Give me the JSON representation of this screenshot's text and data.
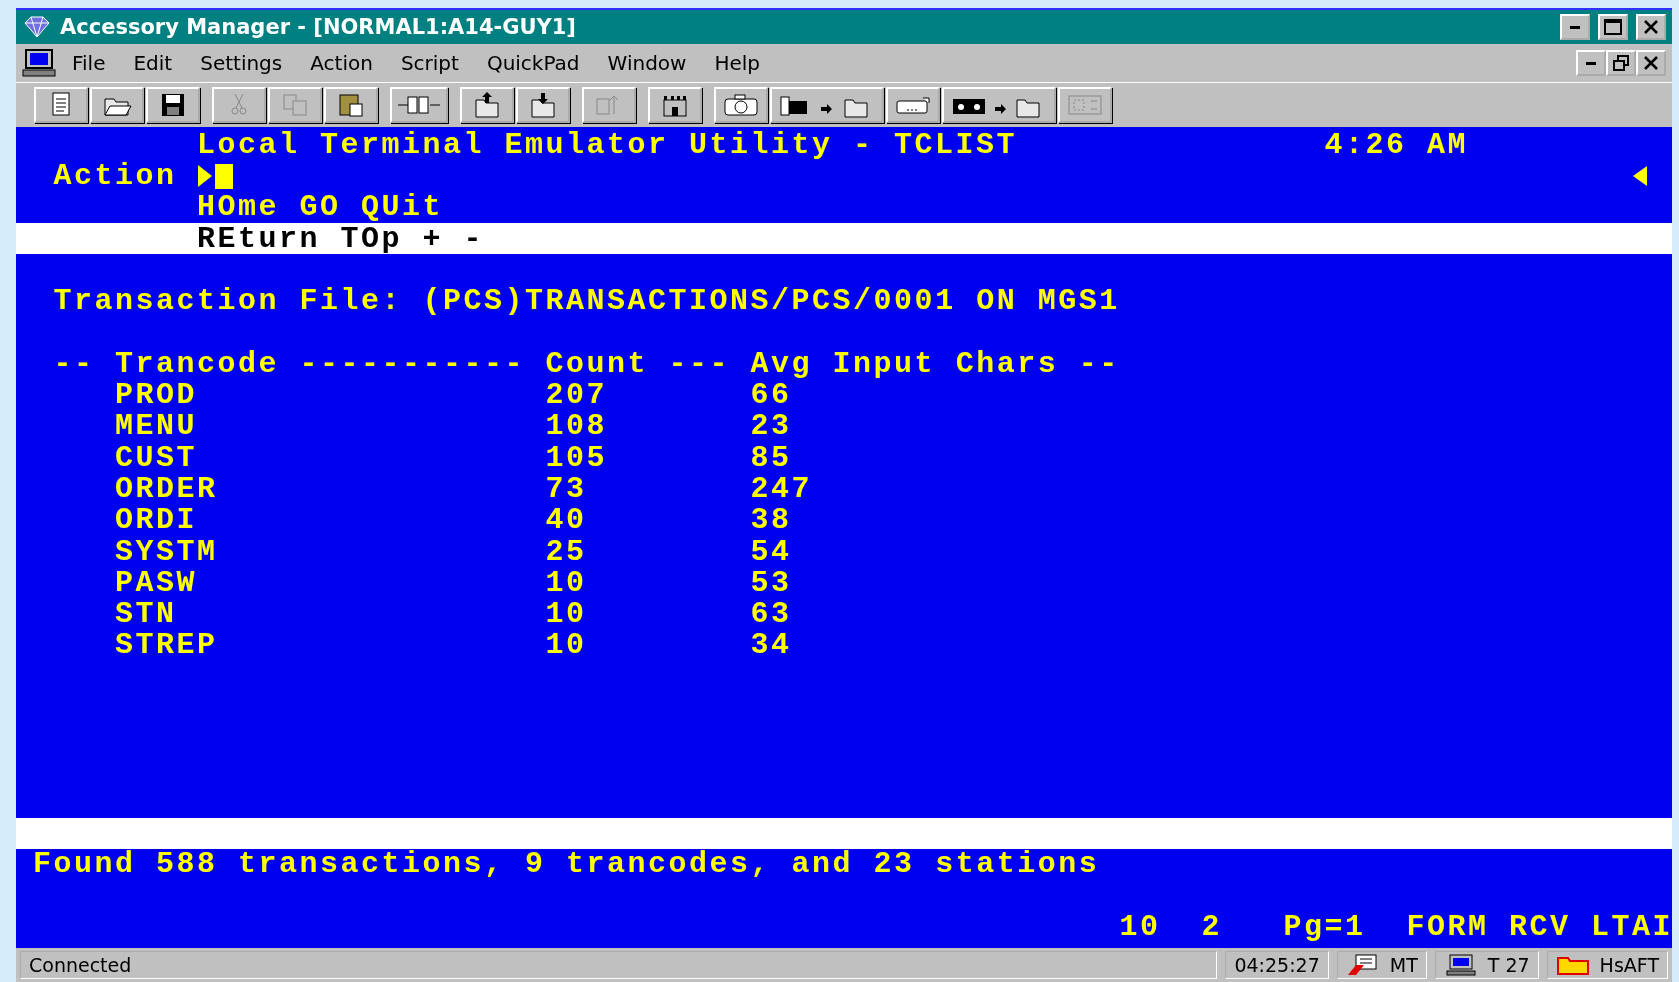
{
  "window": {
    "title": "Accessory Manager - [NORMAL1:A14-GUY1]"
  },
  "menu": [
    "File",
    "Edit",
    "Settings",
    "Action",
    "Script",
    "QuickPad",
    "Window",
    "Help"
  ],
  "toolbar": [
    {
      "kind": "document",
      "disabled": false
    },
    {
      "kind": "open",
      "disabled": false
    },
    {
      "kind": "save",
      "disabled": false
    },
    {
      "kind": "cut",
      "disabled": true
    },
    {
      "kind": "copy",
      "disabled": true
    },
    {
      "kind": "paste",
      "disabled": false
    },
    {
      "kind": "plug",
      "disabled": false
    },
    {
      "kind": "upload",
      "disabled": false
    },
    {
      "kind": "download",
      "disabled": false
    },
    {
      "kind": "send",
      "disabled": true
    },
    {
      "kind": "castle",
      "disabled": false
    },
    {
      "kind": "camera",
      "disabled": false
    },
    {
      "kind": "film-to-folder",
      "disabled": false
    },
    {
      "kind": "camcorder",
      "disabled": false
    },
    {
      "kind": "tape-to-folder",
      "disabled": false
    },
    {
      "kind": "panel",
      "disabled": true
    }
  ],
  "terminal": {
    "title": "Local Terminal Emulator Utility - TCLIST",
    "clock": "4:26 AM",
    "action_label": "Action",
    "commands": "HOme GO QUit",
    "return_line": "REturn TOp + -",
    "transaction_file": "Transaction File: (PCS)TRANSACTIONS/PCS/0001 ON MGS1",
    "header": "-- Trancode ----------- Count --- Avg Input Chars --",
    "rows": [
      {
        "trancode": "PROD",
        "count": "207",
        "avg": "66"
      },
      {
        "trancode": "MENU",
        "count": "108",
        "avg": "23"
      },
      {
        "trancode": "CUST",
        "count": "105",
        "avg": "85"
      },
      {
        "trancode": "ORDER",
        "count": "73",
        "avg": "247"
      },
      {
        "trancode": "ORDI",
        "count": "40",
        "avg": "38"
      },
      {
        "trancode": "SYSTM",
        "count": "25",
        "avg": "54"
      },
      {
        "trancode": "PASW",
        "count": "10",
        "avg": "53"
      },
      {
        "trancode": "STN",
        "count": "10",
        "avg": "63"
      },
      {
        "trancode": "STREP",
        "count": "10",
        "avg": "34"
      }
    ],
    "message": "Found 588 transactions, 9 trancodes, and 23 stations",
    "indicators": [
      "10",
      "2",
      "Pg=1",
      "FORM",
      "RCV",
      "LTAI"
    ]
  },
  "status_bar": {
    "connection": "Connected",
    "time": "04:25:27",
    "network": "MT",
    "terminal": "T 27",
    "folder": "HsAFT"
  }
}
